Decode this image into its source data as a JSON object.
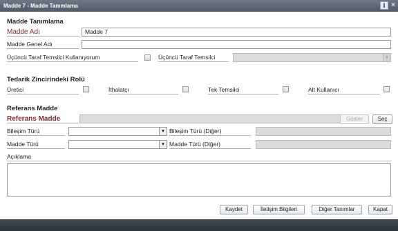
{
  "window": {
    "title": "Madde 7 - Madde Tanımlama",
    "icons": [
      "info-icon",
      "close-icon"
    ],
    "info_glyph": "i",
    "close_glyph": "×"
  },
  "madde_tanimlama": {
    "section_title": "Madde Tanımlama",
    "madde_adi_label": "Madde Adı",
    "madde_adi_value": "Madde 7",
    "madde_genel_adi_label": "Madde Genel Adı",
    "madde_genel_adi_value": "",
    "ucuncu_taraf_kullaniyorum_label": "Üçüncü Taraf Temsilci Kullanıyorum",
    "ucuncu_taraf_temsilci_label": "Üçüncü Taraf Temsilci",
    "ucuncu_taraf_temsilci_value": ""
  },
  "tedarik": {
    "section_title": "Tedarik Zincirindeki Rolü",
    "roles": [
      "Üretici",
      "İthalatçı",
      "Tek Temsilci",
      "Alt Kullanıcı"
    ]
  },
  "referans": {
    "section_title": "Referans Madde",
    "referans_madde_label": "Referans Madde",
    "referans_madde_value": "",
    "goster_button": "Göster",
    "sec_button": "Seç"
  },
  "bilesim": {
    "bilesim_turu_label": "Bileşim Türü",
    "bilesim_turu_value": "",
    "bilesim_turu_diger_label": "Bileşim Türü (Diğer)",
    "madde_turu_label": "Madde Türü",
    "madde_turu_value": "",
    "madde_turu_diger_label": "Madde Türü (Diğer)"
  },
  "aciklama": {
    "label": "Açıklama",
    "value": ""
  },
  "actions": {
    "kaydet": "Kaydet",
    "iletisim": "İletişim Bilgileri",
    "diger": "Diğer Tanımlar",
    "kapat": "Kapat"
  },
  "colors": {
    "titlebar": "#56626e",
    "required_label": "#8a2a2a",
    "footer": "#333d47"
  }
}
